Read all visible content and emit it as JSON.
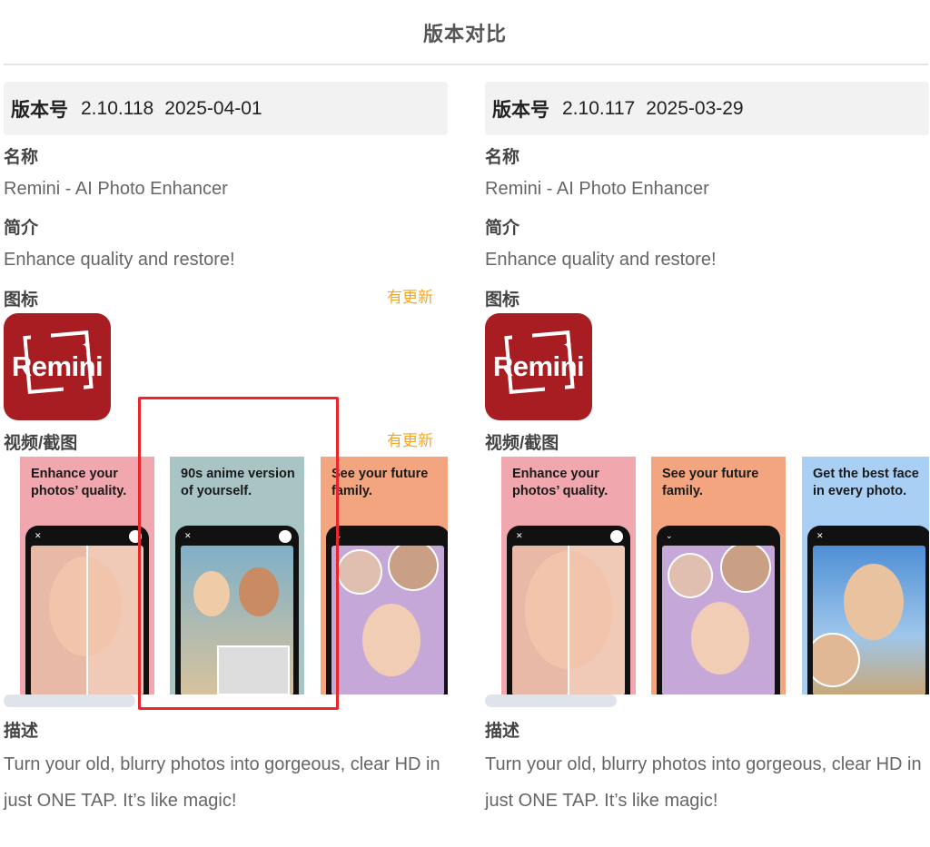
{
  "page": {
    "title": "版本对比"
  },
  "labels": {
    "version": "版本号",
    "name": "名称",
    "intro": "简介",
    "icon": "图标",
    "media": "视频/截图",
    "description": "描述",
    "updated": "有更新"
  },
  "left": {
    "version_number": "2.10.118",
    "date": "2025-04-01",
    "name": "Remini - AI Photo Enhancer",
    "intro": "Enhance quality and restore!",
    "icon_text": "Remini",
    "screenshots": [
      {
        "caption": "Enhance your photos’ quality.",
        "bg": "#f0a7ad"
      },
      {
        "caption": "90s anime version of yourself.",
        "bg": "#a8c4c4"
      },
      {
        "caption": "See your future family.",
        "bg": "#f2a57e"
      }
    ],
    "description": "Turn your old, blurry photos into gorgeous, clear HD in just ONE TAP. It’s like magic!"
  },
  "right": {
    "version_number": "2.10.117",
    "date": "2025-03-29",
    "name": "Remini - AI Photo Enhancer",
    "intro": "Enhance quality and restore!",
    "icon_text": "Remini",
    "screenshots": [
      {
        "caption": "Enhance your photos’ quality.",
        "bg": "#f0a7ad"
      },
      {
        "caption": "See your future family.",
        "bg": "#f2a57e"
      },
      {
        "caption": "Get the best face in every photo.",
        "bg": "#a9cff5"
      }
    ],
    "description": "Turn your old, blurry photos into gorgeous, clear HD in just ONE TAP. It’s like magic!"
  },
  "colors": {
    "accent_update": "#f5a623",
    "icon_bg": "#a81d22",
    "highlight": "#e8262b"
  }
}
